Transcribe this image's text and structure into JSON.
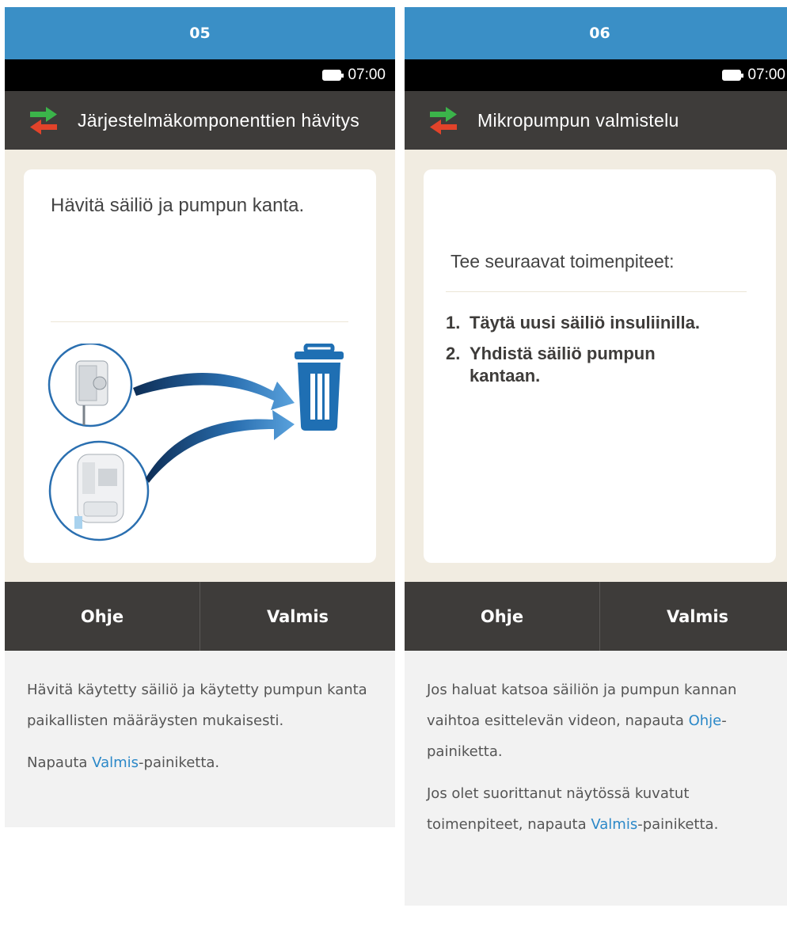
{
  "panels": [
    {
      "step": "05",
      "status": {
        "time": "07:00",
        "battery_icon": "battery-icon"
      },
      "title": "Järjestelmäkomponenttien hävitys",
      "title_icon": "swap-arrows-icon",
      "card_text": "Hävitä säiliö ja pumpun kanta.",
      "buttons": {
        "help": "Ohje",
        "done": "Valmis"
      },
      "note": {
        "p1": "Hävitä käytetty säiliö ja käytetty pumpun kanta paikallisten määräysten mukaisesti.",
        "p2_pre": "Napauta ",
        "p2_link": "Valmis",
        "p2_post": "-painiketta."
      }
    },
    {
      "step": "06",
      "status": {
        "time": "07:00",
        "battery_icon": "battery-icon"
      },
      "title": "Mikropumpun valmistelu",
      "title_icon": "swap-arrows-icon",
      "card_lead": "Tee seuraavat toimenpiteet:",
      "steps": [
        {
          "num": "1.",
          "text": "Täytä uusi säiliö insuliinilla."
        },
        {
          "num": "2.",
          "text": "Yhdistä säiliö pumpun kantaan."
        }
      ],
      "buttons": {
        "help": "Ohje",
        "done": "Valmis"
      },
      "note": {
        "p1_pre": "Jos haluat katsoa säiliön ja pumpun kannan vaihtoa esittelevän videon, napauta ",
        "p1_link": "Ohje",
        "p1_post": "-painiketta.",
        "p2_pre": "Jos olet suorittanut näytössä kuvatut toimenpiteet, napauta ",
        "p2_link": "Valmis",
        "p2_post": "-painiketta."
      }
    }
  ],
  "colors": {
    "header_blue": "#3a8fc6",
    "device_dark": "#3e3c3a",
    "content_beige": "#f1ece1",
    "link_blue": "#2b88c8",
    "trash_blue": "#1f6fb3",
    "arrow_green": "#3bb44a",
    "arrow_red": "#e2432a"
  }
}
